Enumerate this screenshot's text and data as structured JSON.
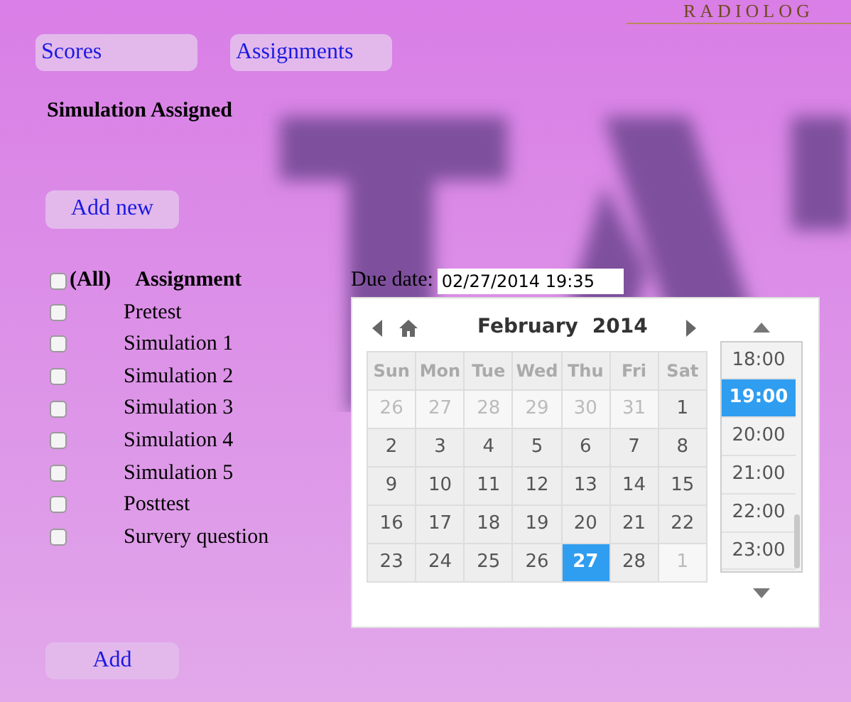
{
  "header_text": "RADIOLOG",
  "nav": [
    {
      "label": "Scores"
    },
    {
      "label": "Assignments"
    }
  ],
  "title": "Simulation Assigned",
  "add_new": "Add new",
  "list": {
    "all_label": "(All)",
    "all_checked": false,
    "heading": "Assignment",
    "items": [
      {
        "label": "Pretest",
        "checked": false
      },
      {
        "label": "Simulation 1",
        "checked": false
      },
      {
        "label": "Simulation 2",
        "checked": false
      },
      {
        "label": "Simulation 3",
        "checked": false
      },
      {
        "label": "Simulation 4",
        "checked": false
      },
      {
        "label": "Simulation 5",
        "checked": false
      },
      {
        "label": "Posttest",
        "checked": false
      },
      {
        "label": "Survery question",
        "checked": false
      }
    ]
  },
  "due_date": {
    "label": "Due date:",
    "value": "02/27/2014 19:35"
  },
  "calendar": {
    "month": "February",
    "year": "2014",
    "weekdays": [
      "Sun",
      "Mon",
      "Tue",
      "Wed",
      "Thu",
      "Fri",
      "Sat"
    ],
    "weeks": [
      [
        {
          "day": "26",
          "other_month": true,
          "selected": false
        },
        {
          "day": "27",
          "other_month": true,
          "selected": false
        },
        {
          "day": "28",
          "other_month": true,
          "selected": false
        },
        {
          "day": "29",
          "other_month": true,
          "selected": false
        },
        {
          "day": "30",
          "other_month": true,
          "selected": false
        },
        {
          "day": "31",
          "other_month": true,
          "selected": false
        },
        {
          "day": "1",
          "other_month": false,
          "selected": false
        }
      ],
      [
        {
          "day": "2",
          "other_month": false,
          "selected": false
        },
        {
          "day": "3",
          "other_month": false,
          "selected": false
        },
        {
          "day": "4",
          "other_month": false,
          "selected": false
        },
        {
          "day": "5",
          "other_month": false,
          "selected": false
        },
        {
          "day": "6",
          "other_month": false,
          "selected": false
        },
        {
          "day": "7",
          "other_month": false,
          "selected": false
        },
        {
          "day": "8",
          "other_month": false,
          "selected": false
        }
      ],
      [
        {
          "day": "9",
          "other_month": false,
          "selected": false
        },
        {
          "day": "10",
          "other_month": false,
          "selected": false
        },
        {
          "day": "11",
          "other_month": false,
          "selected": false
        },
        {
          "day": "12",
          "other_month": false,
          "selected": false
        },
        {
          "day": "13",
          "other_month": false,
          "selected": false
        },
        {
          "day": "14",
          "other_month": false,
          "selected": false
        },
        {
          "day": "15",
          "other_month": false,
          "selected": false
        }
      ],
      [
        {
          "day": "16",
          "other_month": false,
          "selected": false
        },
        {
          "day": "17",
          "other_month": false,
          "selected": false
        },
        {
          "day": "18",
          "other_month": false,
          "selected": false
        },
        {
          "day": "19",
          "other_month": false,
          "selected": false
        },
        {
          "day": "20",
          "other_month": false,
          "selected": false
        },
        {
          "day": "21",
          "other_month": false,
          "selected": false
        },
        {
          "day": "22",
          "other_month": false,
          "selected": false
        }
      ],
      [
        {
          "day": "23",
          "other_month": false,
          "selected": false
        },
        {
          "day": "24",
          "other_month": false,
          "selected": false
        },
        {
          "day": "25",
          "other_month": false,
          "selected": false
        },
        {
          "day": "26",
          "other_month": false,
          "selected": false
        },
        {
          "day": "27",
          "other_month": false,
          "selected": true
        },
        {
          "day": "28",
          "other_month": false,
          "selected": false
        },
        {
          "day": "1",
          "other_month": true,
          "selected": false
        }
      ]
    ],
    "times": [
      {
        "label": "18:00",
        "selected": false
      },
      {
        "label": "19:00",
        "selected": true
      },
      {
        "label": "20:00",
        "selected": false
      },
      {
        "label": "21:00",
        "selected": false
      },
      {
        "label": "22:00",
        "selected": false
      },
      {
        "label": "23:00",
        "selected": false
      }
    ]
  },
  "add": "Add"
}
